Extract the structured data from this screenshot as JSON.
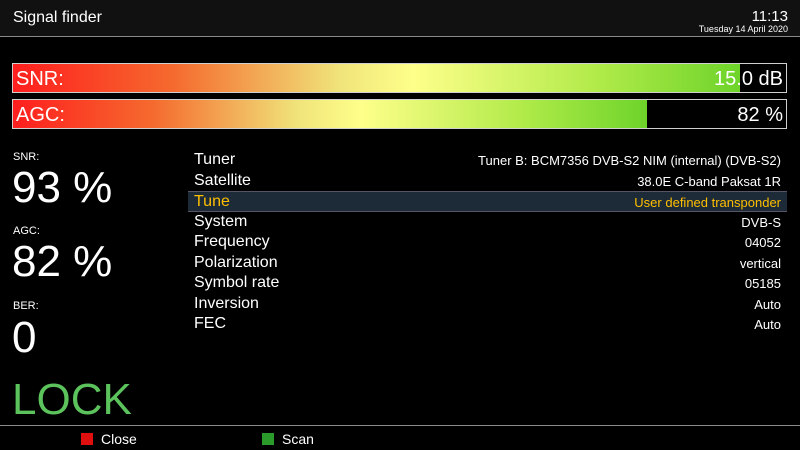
{
  "header": {
    "title": "Signal finder",
    "time": "11:13",
    "date": "Tuesday 14 April 2020"
  },
  "bars": {
    "snr": {
      "label": "SNR:",
      "value": "15.0 dB",
      "level": 0.94
    },
    "agc": {
      "label": "AGC:",
      "value": "82 %",
      "level": 0.82
    }
  },
  "stats": {
    "snr": {
      "label": "SNR:",
      "value": "93 %"
    },
    "agc": {
      "label": "AGC:",
      "value": "82 %"
    },
    "ber": {
      "label": "BER:",
      "value": "0"
    },
    "lock": "LOCK"
  },
  "info": [
    {
      "key": "Tuner",
      "value": "Tuner B: BCM7356 DVB-S2 NIM (internal) (DVB-S2)",
      "selected": false
    },
    {
      "key": "Satellite",
      "value": "38.0E C-band Paksat 1R",
      "selected": false
    },
    {
      "key": "Tune",
      "value": "User defined transponder",
      "selected": true
    },
    {
      "key": "System",
      "value": "DVB-S",
      "selected": false
    },
    {
      "key": "Frequency",
      "value": "04052",
      "selected": false
    },
    {
      "key": "Polarization",
      "value": "vertical",
      "selected": false
    },
    {
      "key": "Symbol rate",
      "value": "05185",
      "selected": false
    },
    {
      "key": "Inversion",
      "value": "Auto",
      "selected": false
    },
    {
      "key": "FEC",
      "value": "Auto",
      "selected": false
    }
  ],
  "footer": {
    "close": {
      "label": "Close",
      "color": "#e01010"
    },
    "scan": {
      "label": "Scan",
      "color": "#2a9a2a"
    }
  }
}
